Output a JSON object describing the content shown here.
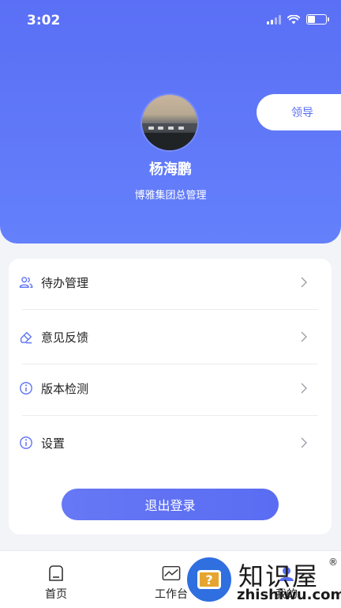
{
  "status_bar": {
    "time": "3:02"
  },
  "profile": {
    "name": "杨海鹏",
    "organization": "博雅集团总管理",
    "role_tag": "领导"
  },
  "menu": {
    "items": [
      {
        "label": "待办管理",
        "icon": "users-icon"
      },
      {
        "label": "意见反馈",
        "icon": "eraser-icon"
      },
      {
        "label": "版本检测",
        "icon": "info-icon"
      },
      {
        "label": "设置",
        "icon": "info-icon"
      }
    ],
    "logout_label": "退出登录"
  },
  "tabbar": {
    "tabs": [
      {
        "label": "首页",
        "icon": "home-icon"
      },
      {
        "label": "工作台",
        "icon": "chart-icon"
      },
      {
        "label": "我的",
        "icon": "user-icon"
      }
    ]
  },
  "watermark": {
    "text_cn": "知识屋",
    "text_en": "zhishiwu.com",
    "reg": "®"
  },
  "colors": {
    "primary": "#5a6ff5",
    "header_gradient_end": "#6480fb"
  }
}
